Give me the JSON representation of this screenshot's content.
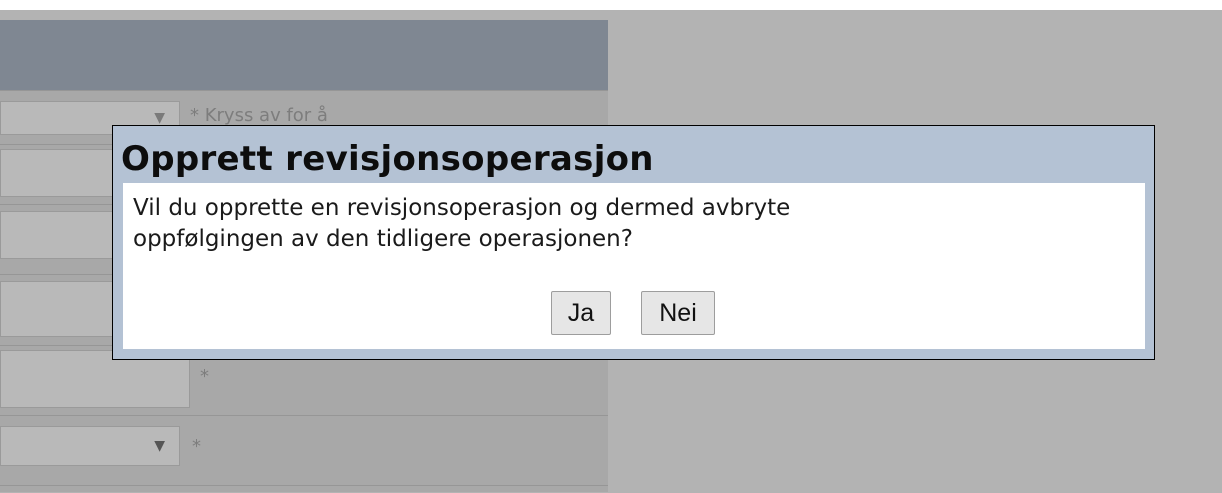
{
  "form": {
    "hint_top": "* Kryss av for å",
    "required_1": "*",
    "required_2": "*"
  },
  "dialog": {
    "title": "Opprett revisjonsoperasjon",
    "message_line1": "Vil du opprette en revisjonsoperasjon og dermed avbryte",
    "message_line2": "oppfølgingen av den tidligere operasjonen?",
    "yes_label": "Ja",
    "no_label": "Nei"
  },
  "icons": {
    "dropdown": "chevron-down-icon"
  },
  "colors": {
    "overlay": "#b3b3b3",
    "dialog_frame": "#b4c2d4",
    "panel_header": "#7f8792"
  }
}
